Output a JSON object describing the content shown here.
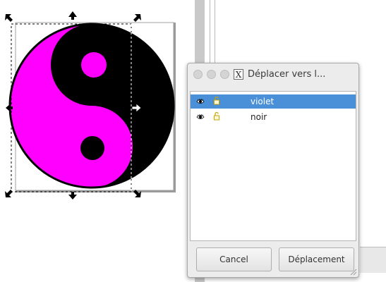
{
  "dialog": {
    "title": "Déplacer vers l...",
    "icon": "app-x-icon",
    "icon_glyph": "X",
    "layers": [
      {
        "name": "violet",
        "visible": true,
        "locked": false,
        "selected": true
      },
      {
        "name": "noir",
        "visible": true,
        "locked": false,
        "selected": false
      }
    ],
    "cancel_label": "Cancel",
    "move_label": "Déplacement"
  },
  "canvas": {
    "shape": "yin-yang",
    "colors": {
      "primary": "#ff00ff",
      "secondary": "#000000",
      "selection": "#4a90d9"
    }
  }
}
